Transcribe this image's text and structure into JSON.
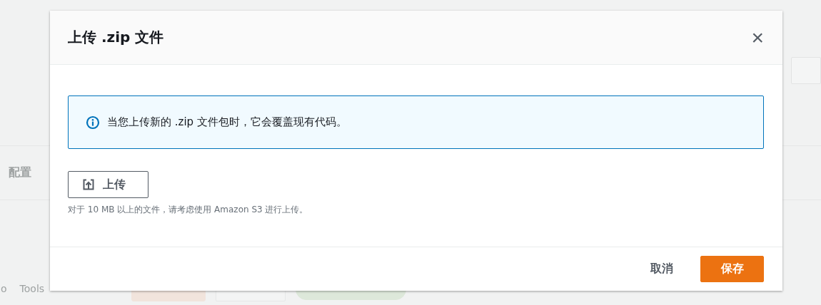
{
  "background": {
    "tab": "配置",
    "menu": [
      "o",
      "Tools"
    ]
  },
  "dialog": {
    "title": "上传 .zip 文件",
    "close": "×",
    "alert": {
      "kind": "info",
      "text": "当您上传新的 .zip 文件包时，它会覆盖现有代码。"
    },
    "upload_button": "上传",
    "hint": "对于 10 MB 以上的文件，请考虑使用 Amazon S3 进行上传。",
    "buttons": [
      {
        "label": "取消",
        "kind": "link"
      },
      {
        "label": "保存",
        "kind": "primary"
      }
    ]
  }
}
